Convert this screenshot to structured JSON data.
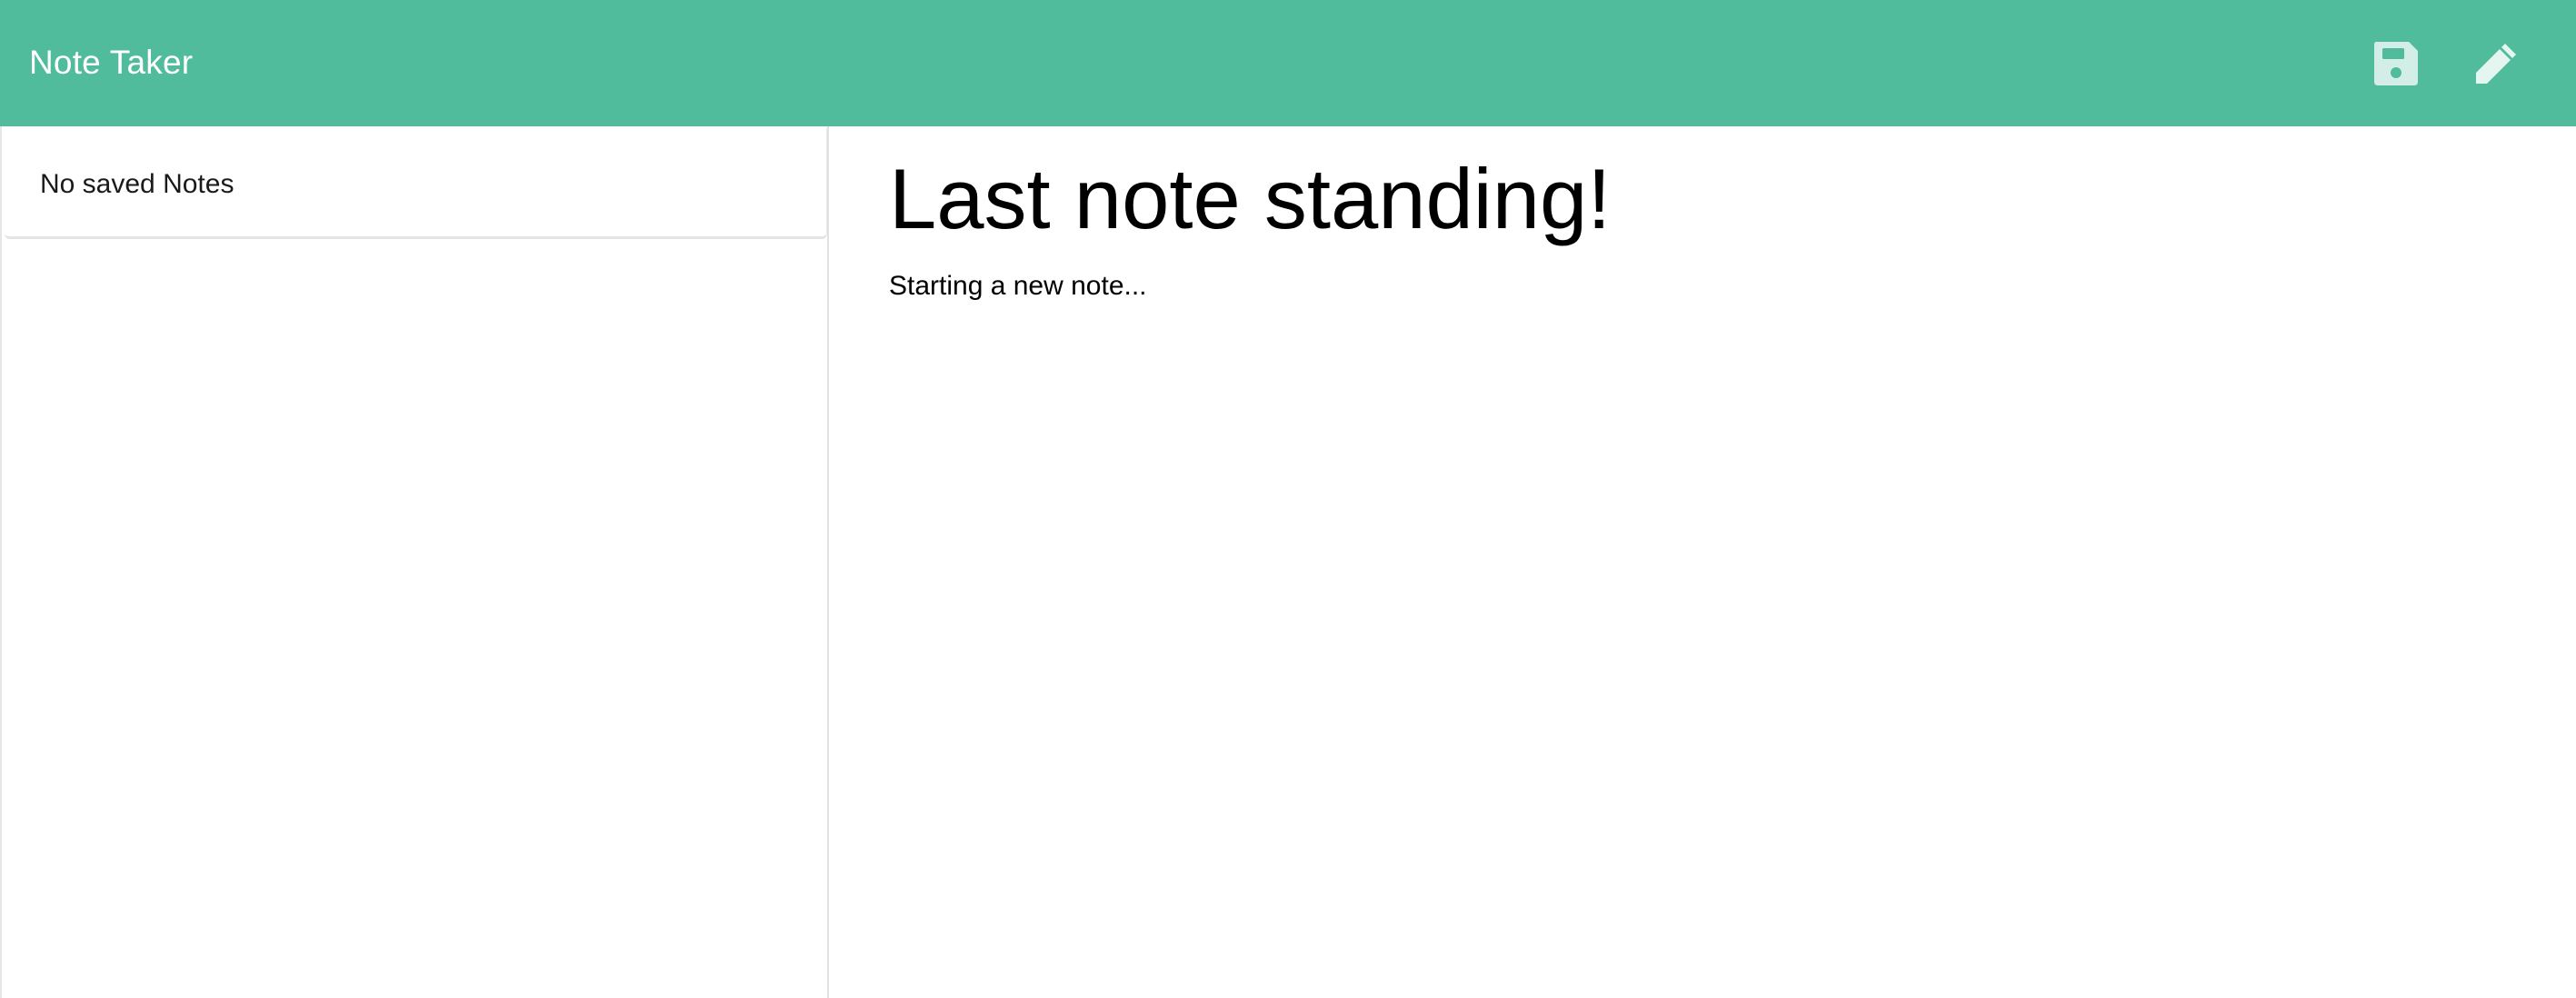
{
  "header": {
    "brand": "Note Taker",
    "bg_color": "#50bc9c",
    "actions": [
      {
        "name": "save-note",
        "icon": "floppy-disk-icon"
      },
      {
        "name": "new-note",
        "icon": "pencil-icon"
      }
    ]
  },
  "sidebar": {
    "empty_message": "No saved Notes"
  },
  "note": {
    "title": "Last note standing!",
    "text": "Starting a new note..."
  }
}
